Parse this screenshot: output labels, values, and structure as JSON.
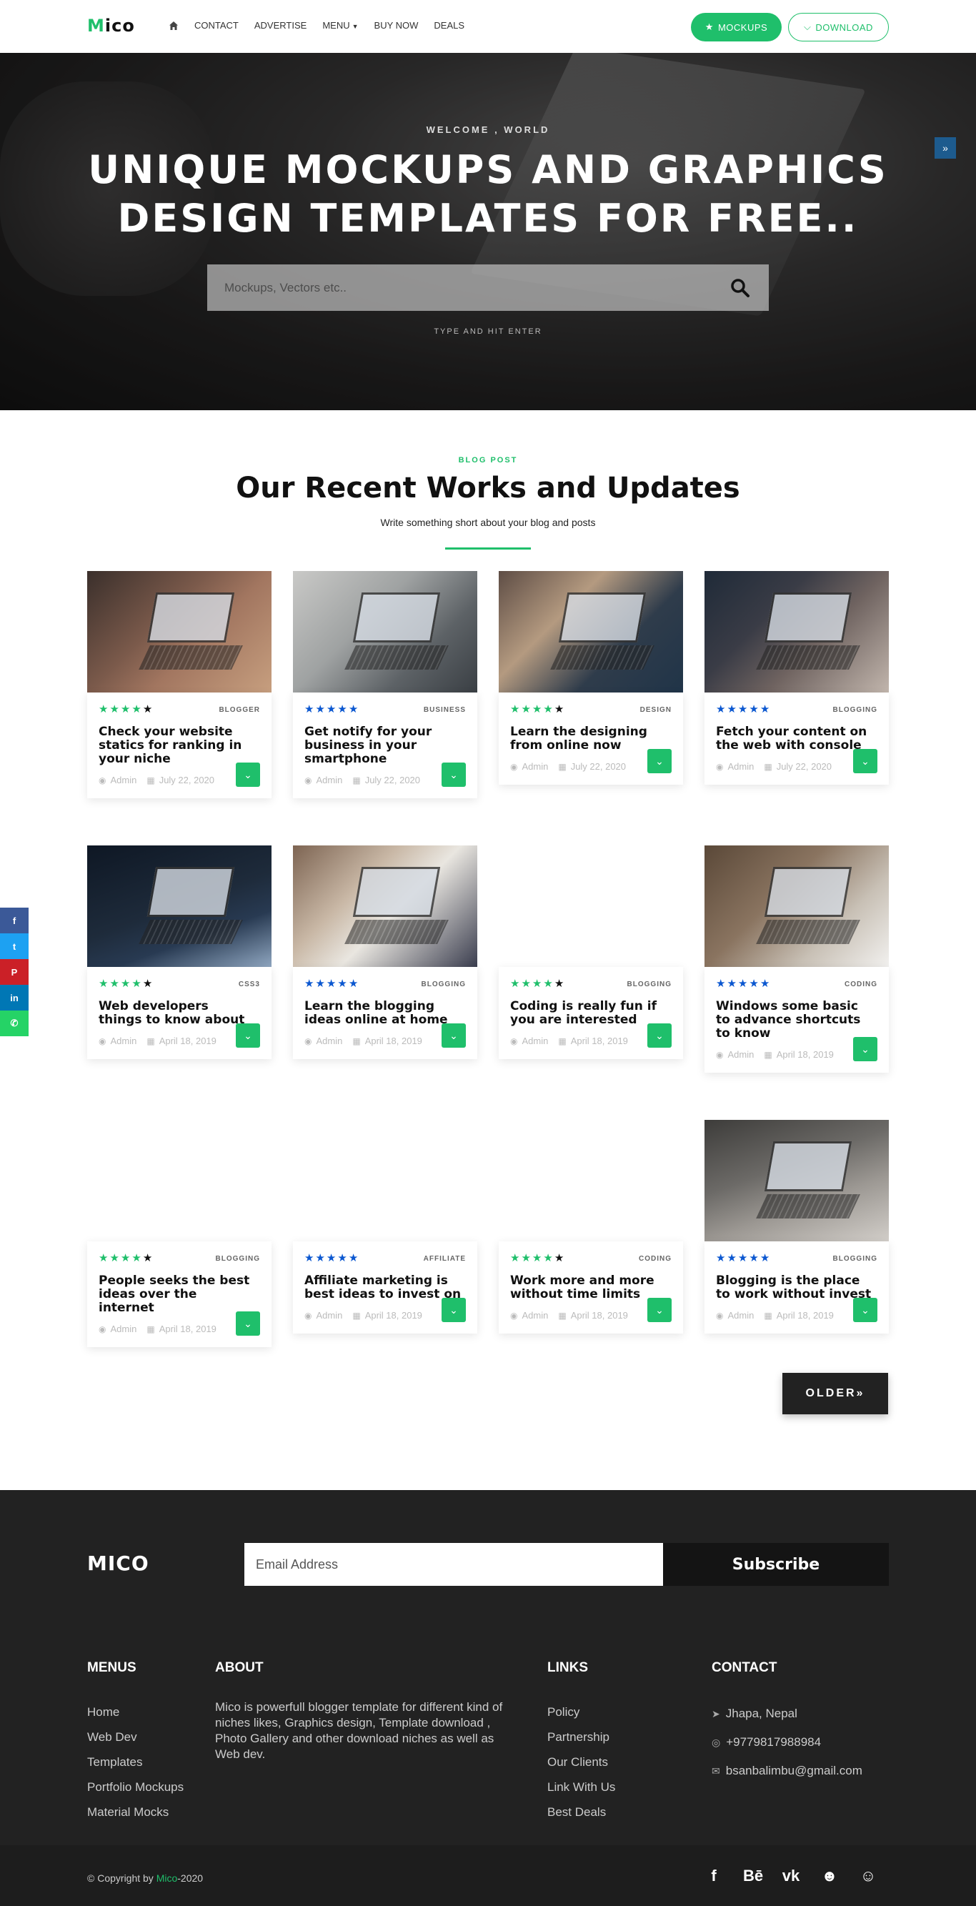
{
  "header": {
    "logo_first": "M",
    "logo_rest": "ico",
    "nav": [
      "CONTACT",
      "ADVERTISE",
      "MENU",
      "BUY NOW",
      "DEALS"
    ],
    "mockups_label": "MOCKUPS",
    "download_label": "DOWNLOAD"
  },
  "hero": {
    "kicker": "WELCOME , WORLD",
    "title_line1": "UNIQUE MOCKUPS AND GRAPHICS",
    "title_line2": "DESIGN TEMPLATES FOR FREE..",
    "search_placeholder": "Mockups, Vectors etc..",
    "hint": "TYPE AND HIT ENTER"
  },
  "section": {
    "kicker": "BLOG POST",
    "title": "Our Recent Works and Updates",
    "subtitle": "Write something short about your blog and posts"
  },
  "posts": [
    {
      "category": "BLOGGER",
      "title": "Check your website statics for ranking in your niche",
      "author": "Admin",
      "date": "July 22, 2020",
      "stars": 4,
      "star_color": "green"
    },
    {
      "category": "BUSINESS",
      "title": "Get notify for your business in your smartphone",
      "author": "Admin",
      "date": "July 22, 2020",
      "stars": 5,
      "star_color": "blue"
    },
    {
      "category": "DESIGN",
      "title": "Learn the designing from online now",
      "author": "Admin",
      "date": "July 22, 2020",
      "stars": 4,
      "star_color": "green"
    },
    {
      "category": "BLOGGING",
      "title": "Fetch your content on the web with console",
      "author": "Admin",
      "date": "July 22, 2020",
      "stars": 5,
      "star_color": "blue"
    },
    {
      "category": "CSS3",
      "title": "Web developers things to know about",
      "author": "Admin",
      "date": "April 18, 2019",
      "stars": 4,
      "star_color": "green"
    },
    {
      "category": "BLOGGING",
      "title": "Learn the blogging ideas online at home",
      "author": "Admin",
      "date": "April 18, 2019",
      "stars": 5,
      "star_color": "blue"
    },
    {
      "category": "BLOGGING",
      "title": "Coding is really fun if you are interested",
      "author": "Admin",
      "date": "April 18, 2019",
      "stars": 4,
      "star_color": "green"
    },
    {
      "category": "CODING",
      "title": "Windows some basic to advance shortcuts to know",
      "author": "Admin",
      "date": "April 18, 2019",
      "stars": 5,
      "star_color": "blue"
    },
    {
      "category": "BLOGGING",
      "title": "People seeks the best ideas over the internet",
      "author": "Admin",
      "date": "April 18, 2019",
      "stars": 4,
      "star_color": "green"
    },
    {
      "category": "AFFILIATE",
      "title": "Affiliate marketing is best ideas to invest on",
      "author": "Admin",
      "date": "April 18, 2019",
      "stars": 5,
      "star_color": "blue"
    },
    {
      "category": "CODING",
      "title": "Work more and more without time limits",
      "author": "Admin",
      "date": "April 18, 2019",
      "stars": 4,
      "star_color": "green"
    },
    {
      "category": "BLOGGING",
      "title": "Blogging is the place to work without invest",
      "author": "Admin",
      "date": "April 18, 2019",
      "stars": 5,
      "star_color": "blue"
    }
  ],
  "older_label": "OLDER",
  "footer": {
    "logo": "MICO",
    "email_placeholder": "Email Address",
    "subscribe_label": "Subscribe",
    "menus_title": "MENUS",
    "menus": [
      "Home",
      "Web Dev",
      "Templates",
      "Portfolio Mockups",
      "Material Mocks"
    ],
    "about_title": "ABOUT",
    "about_text": "Mico is powerfull blogger template for different kind of niches likes, Graphics design, Template download , Photo Gallery and other download niches as well as Web dev.",
    "links_title": "LINKS",
    "links": [
      "Policy",
      "Partnership",
      "Our Clients",
      "Link With Us",
      "Best Deals"
    ],
    "contact_title": "CONTACT",
    "contact_location": "Jhapa, Nepal",
    "contact_phone": "+9779817988984",
    "contact_email": "bsanbalimbu@gmail.com",
    "copyright_prefix": "Copyright by",
    "copyright_brand": "Mico",
    "copyright_suffix": "-2020",
    "social_icons": [
      "facebook-icon",
      "behance-icon",
      "vk-icon",
      "reddit-icon",
      "snapchat-icon"
    ]
  },
  "sidebar_social": [
    {
      "icon": "facebook-icon",
      "color": "#3b5998"
    },
    {
      "icon": "twitter-icon",
      "color": "#1da1f2"
    },
    {
      "icon": "pinterest-icon",
      "color": "#cb2027"
    },
    {
      "icon": "linkedin-icon",
      "color": "#0077b5"
    },
    {
      "icon": "whatsapp-icon",
      "color": "#25d366"
    }
  ],
  "colors": {
    "accent": "#1fbf6b",
    "dark": "#222222",
    "star_blue": "#0b57d0"
  }
}
